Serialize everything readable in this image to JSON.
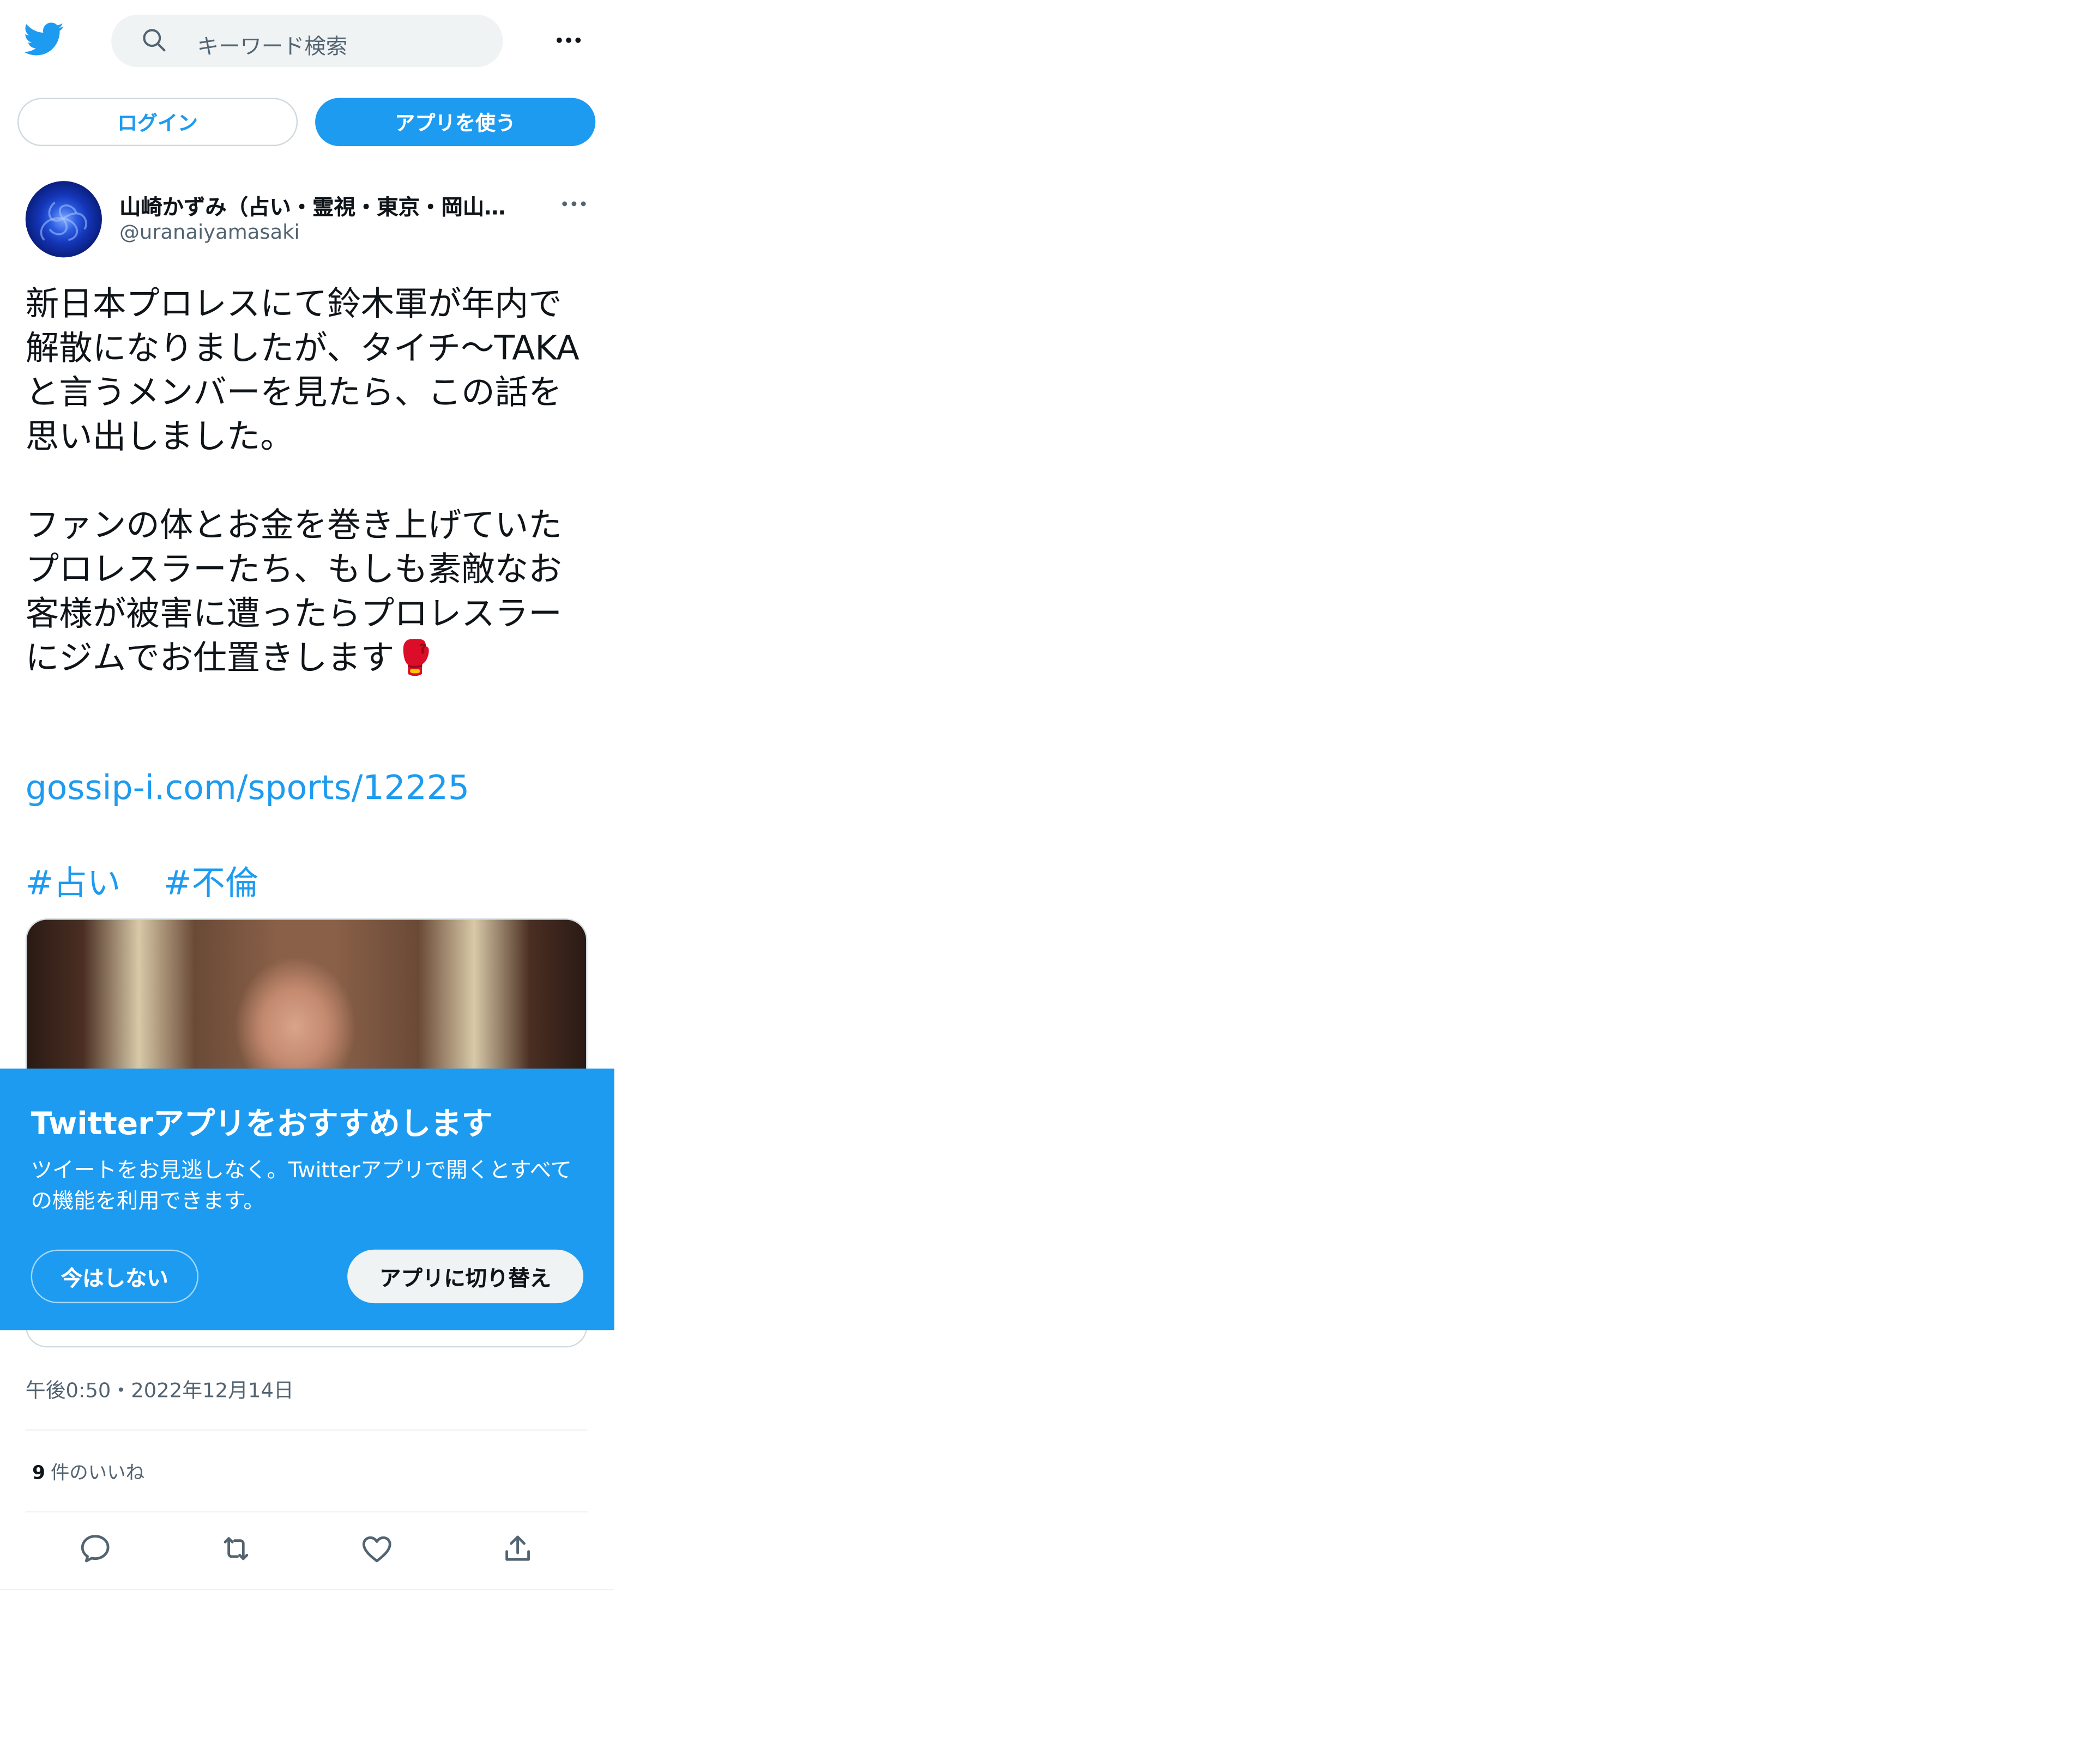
{
  "header": {
    "search_placeholder": "キーワード検索"
  },
  "auth_buttons": {
    "login_label": "ログイン",
    "use_app_label": "アプリを使う"
  },
  "tweet": {
    "author_name": "山崎かずみ（占い・霊視・東京・岡山…",
    "author_handle": "@uranaiyamasaki",
    "text": "新日本プロレスにて鈴木軍が年内で解散になりましたが、タイチ〜TAKAと言うメンバーを見たら、この話を思い出しました。\n\nファンの体とお金を巻き上げていたプロレスラーたち、もしも素敵なお客様が被害に遭ったらプロレスラーにジムでお仕置きします🥊",
    "link": "gossip-i.com/sports/12225",
    "hashtags": [
      "#占い",
      "#不倫"
    ],
    "timestamp": "午後0:50・2022年12月14日",
    "likes_count": "9",
    "likes_label": "件のいいね"
  },
  "app_banner": {
    "title": "Twitterアプリをおすすめします",
    "body": "ツイートをお見逃しなく。Twitterアプリで開くとすべての機能を利用できます。",
    "not_now_label": "今はしない",
    "switch_label": "アプリに切り替え"
  },
  "colors": {
    "accent": "#1d9bf0",
    "text_primary": "#0f1419",
    "text_secondary": "#536471",
    "divider": "#eff3f4"
  },
  "icons": [
    "twitter-logo-icon",
    "search-icon",
    "more-icon",
    "reply-icon",
    "retweet-icon",
    "like-icon",
    "share-icon"
  ]
}
